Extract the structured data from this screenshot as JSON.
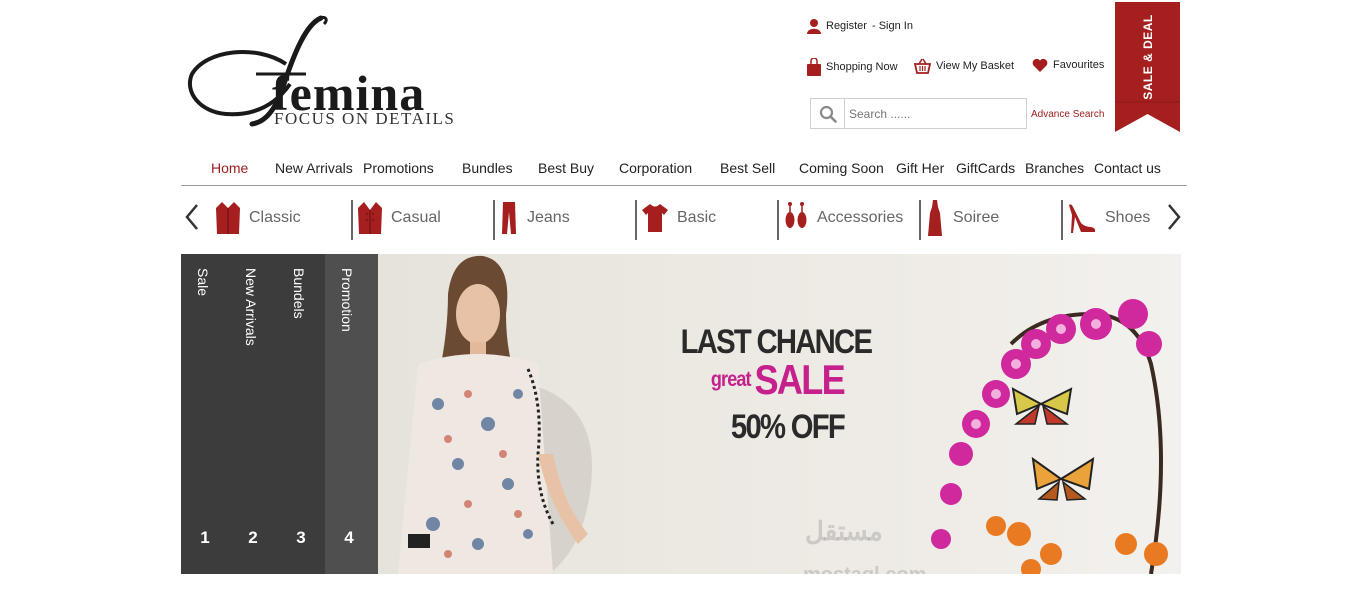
{
  "brand": {
    "name": "femina",
    "tagline": "FOCUS ON DETAILS"
  },
  "top_links": {
    "register": "Register",
    "sign_in": "- Sign In",
    "shopping_now": "Shopping Now",
    "view_basket": "View My Basket",
    "favourites": "Favourites"
  },
  "search": {
    "placeholder": "Search ......",
    "advance": "Advance Search"
  },
  "ribbon": {
    "label": "SALE & DEAL"
  },
  "main_nav": [
    {
      "label": "Home",
      "active": true
    },
    {
      "label": "New Arrivals"
    },
    {
      "label": "Promotions"
    },
    {
      "label": "Bundles"
    },
    {
      "label": "Best Buy"
    },
    {
      "label": "Corporation"
    },
    {
      "label": "Best Sell"
    },
    {
      "label": "Coming Soon"
    },
    {
      "label": "Gift Her"
    },
    {
      "label": "GiftCards"
    },
    {
      "label": "Branches"
    },
    {
      "label": "Contact us"
    }
  ],
  "categories": [
    {
      "label": "Classic",
      "icon": "jacket-icon"
    },
    {
      "label": "Casual",
      "icon": "cardigan-icon"
    },
    {
      "label": "Jeans",
      "icon": "pants-icon"
    },
    {
      "label": "Basic",
      "icon": "tshirt-icon"
    },
    {
      "label": "Accessories",
      "icon": "earrings-icon"
    },
    {
      "label": "Soiree",
      "icon": "dress-icon"
    },
    {
      "label": "Shoes",
      "icon": "heel-shoe-icon"
    }
  ],
  "slider_tabs": [
    {
      "label": "Sale",
      "num": "1"
    },
    {
      "label": "New Arrivals",
      "num": "2"
    },
    {
      "label": "Bundels",
      "num": "3"
    },
    {
      "label": "Promotion",
      "num": "4",
      "active": true
    }
  ],
  "banner": {
    "line1": "LAST CHANCE",
    "great": "great",
    "sale": "SALE",
    "line3": "50% OFF"
  },
  "watermark": {
    "arabic": "مستقل",
    "latin": "mostaql.com"
  },
  "colors": {
    "accent": "#9b1c1c",
    "ribbon": "#a51f1f",
    "tabs": "#3c3c3c",
    "magenta": "#c5208b"
  }
}
